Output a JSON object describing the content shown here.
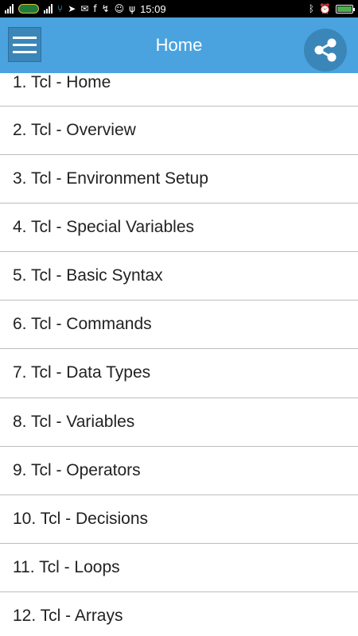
{
  "status_bar": {
    "time": "15:09",
    "battery_level": 1.0
  },
  "app_bar": {
    "title": "Home",
    "menu_icon": "hamburger-menu-icon",
    "share_icon": "share-icon"
  },
  "colors": {
    "app_bar": "#4aa3df",
    "app_bar_dark": "#3b86b9",
    "divider": "#bdbdbd"
  },
  "topics": [
    {
      "label": "1. Tcl - Home"
    },
    {
      "label": "2. Tcl - Overview"
    },
    {
      "label": "3. Tcl - Environment Setup"
    },
    {
      "label": "4. Tcl - Special Variables"
    },
    {
      "label": "5. Tcl - Basic Syntax"
    },
    {
      "label": "6. Tcl - Commands"
    },
    {
      "label": "7. Tcl - Data Types"
    },
    {
      "label": "8. Tcl - Variables"
    },
    {
      "label": "9. Tcl - Operators"
    },
    {
      "label": "10. Tcl - Decisions"
    },
    {
      "label": "11. Tcl - Loops"
    },
    {
      "label": "12. Tcl - Arrays"
    }
  ]
}
